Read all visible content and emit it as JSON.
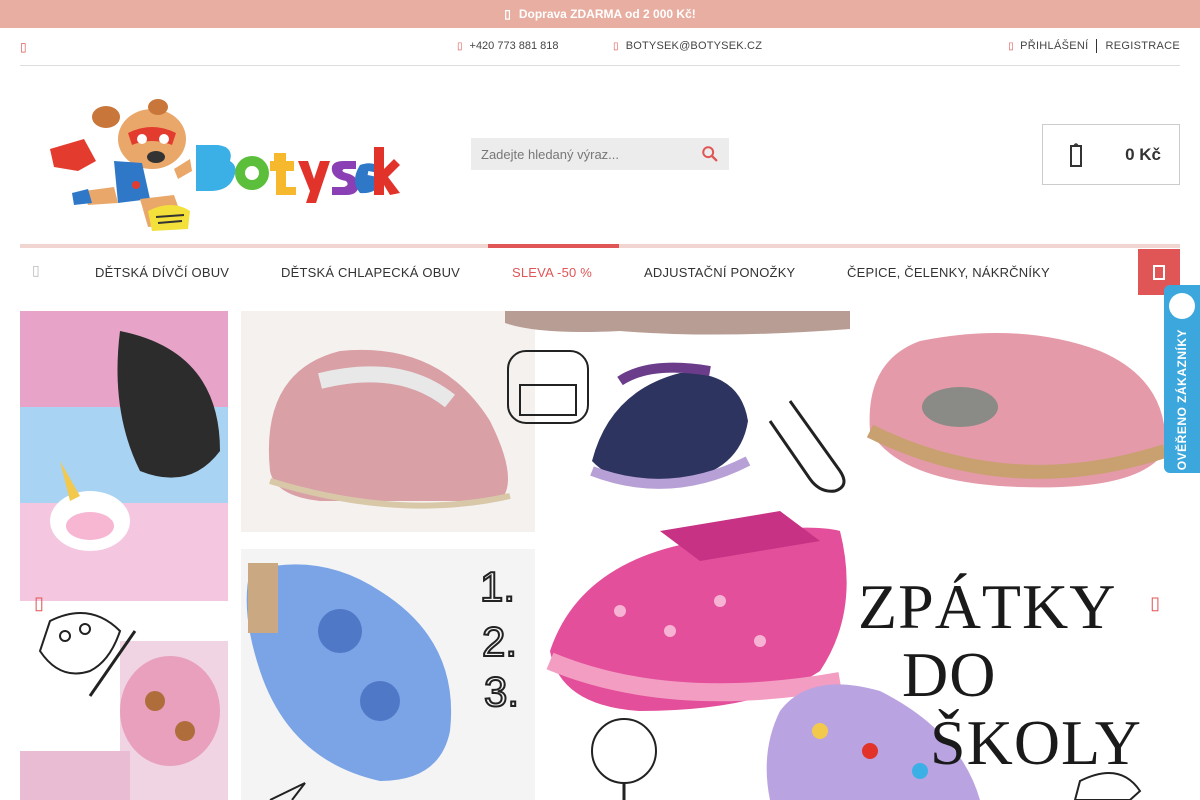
{
  "promo": {
    "text": "Doprava ZDARMA od 2 000 Kč!",
    "icon": "truck-icon"
  },
  "topbar": {
    "phone": "+420 773 881 818",
    "email": "BOTYSEK@BOTYSEK.CZ",
    "login": "PŘIHLÁŠENÍ",
    "register": "REGISTRACE"
  },
  "header": {
    "search_placeholder": "Zadejte hledaný výraz...",
    "cart_total": "0 Kč"
  },
  "nav": {
    "items": [
      "DĚTSKÁ DÍVČÍ OBUV",
      "DĚTSKÁ CHLAPECKÁ OBUV",
      "SLEVA -50 %",
      "ADJUSTAČNÍ PONOŽKY",
      "ČEPICE, ČELENKY, NÁKRČNÍKY"
    ]
  },
  "hero": {
    "title_line1": "ZPÁTKY",
    "title_line2": "DO",
    "title_line3": "ŠKOLY"
  },
  "verified_badge": {
    "text": "OVĚŘENO ZÁKAZNÍKY"
  },
  "colors": {
    "accent": "#e05555",
    "promo_bg": "#e8aea1",
    "verified_bg": "#3ba7dd"
  }
}
